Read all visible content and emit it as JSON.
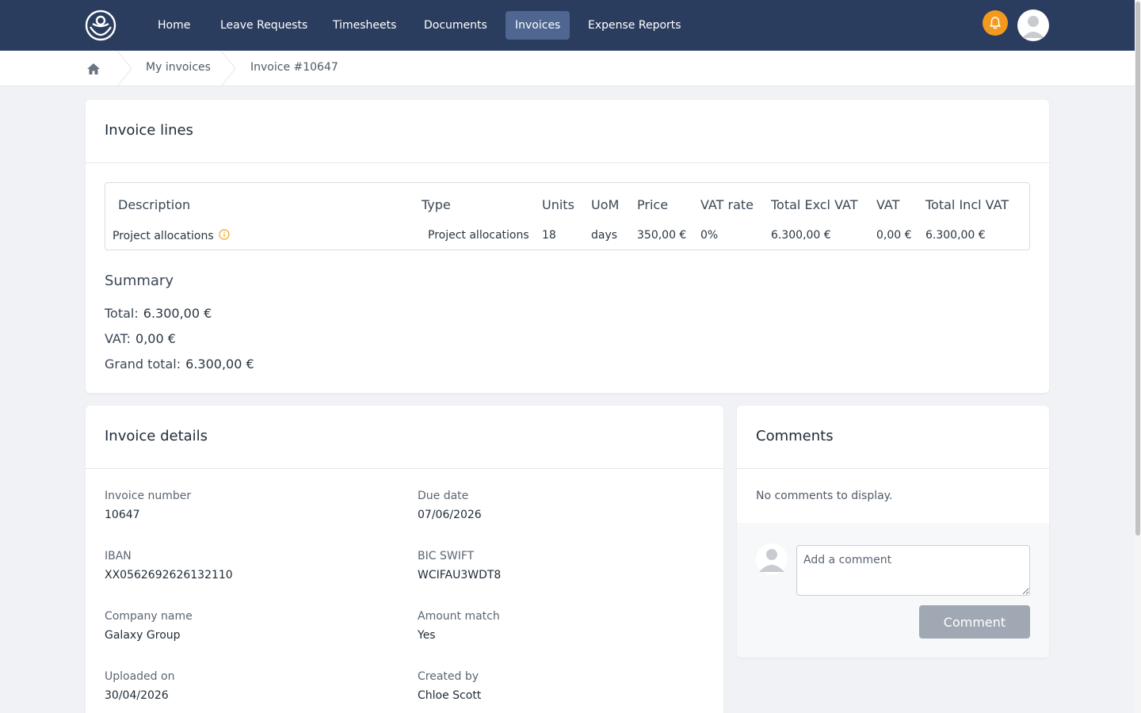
{
  "nav": {
    "items": [
      {
        "label": "Home"
      },
      {
        "label": "Leave Requests"
      },
      {
        "label": "Timesheets"
      },
      {
        "label": "Documents"
      },
      {
        "label": "Invoices",
        "active": true
      },
      {
        "label": "Expense Reports"
      }
    ],
    "bell_color": "#f39a1e",
    "bar_color": "#2b3d5f"
  },
  "breadcrumb": {
    "home_icon": "home-icon",
    "items": [
      {
        "label": "My invoices"
      },
      {
        "label": "Invoice #10647"
      }
    ]
  },
  "invoice_lines": {
    "title": "Invoice lines",
    "headers": {
      "description": "Description",
      "type": "Type",
      "units": "Units",
      "uom": "UoM",
      "price": "Price",
      "vat_rate": "VAT rate",
      "total_excl_vat": "Total Excl VAT",
      "vat": "VAT",
      "total_incl_vat": "Total Incl VAT"
    },
    "rows": [
      {
        "description": "Project allocations",
        "type": "Project allocations",
        "units": "18",
        "uom": "days",
        "price": "350,00 €",
        "vat_rate": "0%",
        "total_excl_vat": "6.300,00 €",
        "vat": "0,00 €",
        "total_incl_vat": "6.300,00 €"
      }
    ]
  },
  "summary": {
    "title": "Summary",
    "total_label": "Total:",
    "total_value": "6.300,00 €",
    "vat_label": "VAT:",
    "vat_value": "0,00 €",
    "grand_total_label": "Grand total:",
    "grand_total_value": "6.300,00 €"
  },
  "invoice_details": {
    "title": "Invoice details",
    "fields": [
      {
        "label": "Invoice number",
        "value": "10647"
      },
      {
        "label": "Due date",
        "value": "07/06/2026"
      },
      {
        "label": "IBAN",
        "value": "XX0562692626132110"
      },
      {
        "label": "BIC SWIFT",
        "value": "WCIFAU3WDT8"
      },
      {
        "label": "Company name",
        "value": "Galaxy Group"
      },
      {
        "label": "Amount match",
        "value": "Yes"
      },
      {
        "label": "Uploaded on",
        "value": "30/04/2026"
      },
      {
        "label": "Created by",
        "value": "Chloe Scott"
      }
    ]
  },
  "comments": {
    "title": "Comments",
    "empty_text": "No comments to display.",
    "input_placeholder": "Add a comment",
    "input_value": "",
    "button_label": "Comment"
  }
}
